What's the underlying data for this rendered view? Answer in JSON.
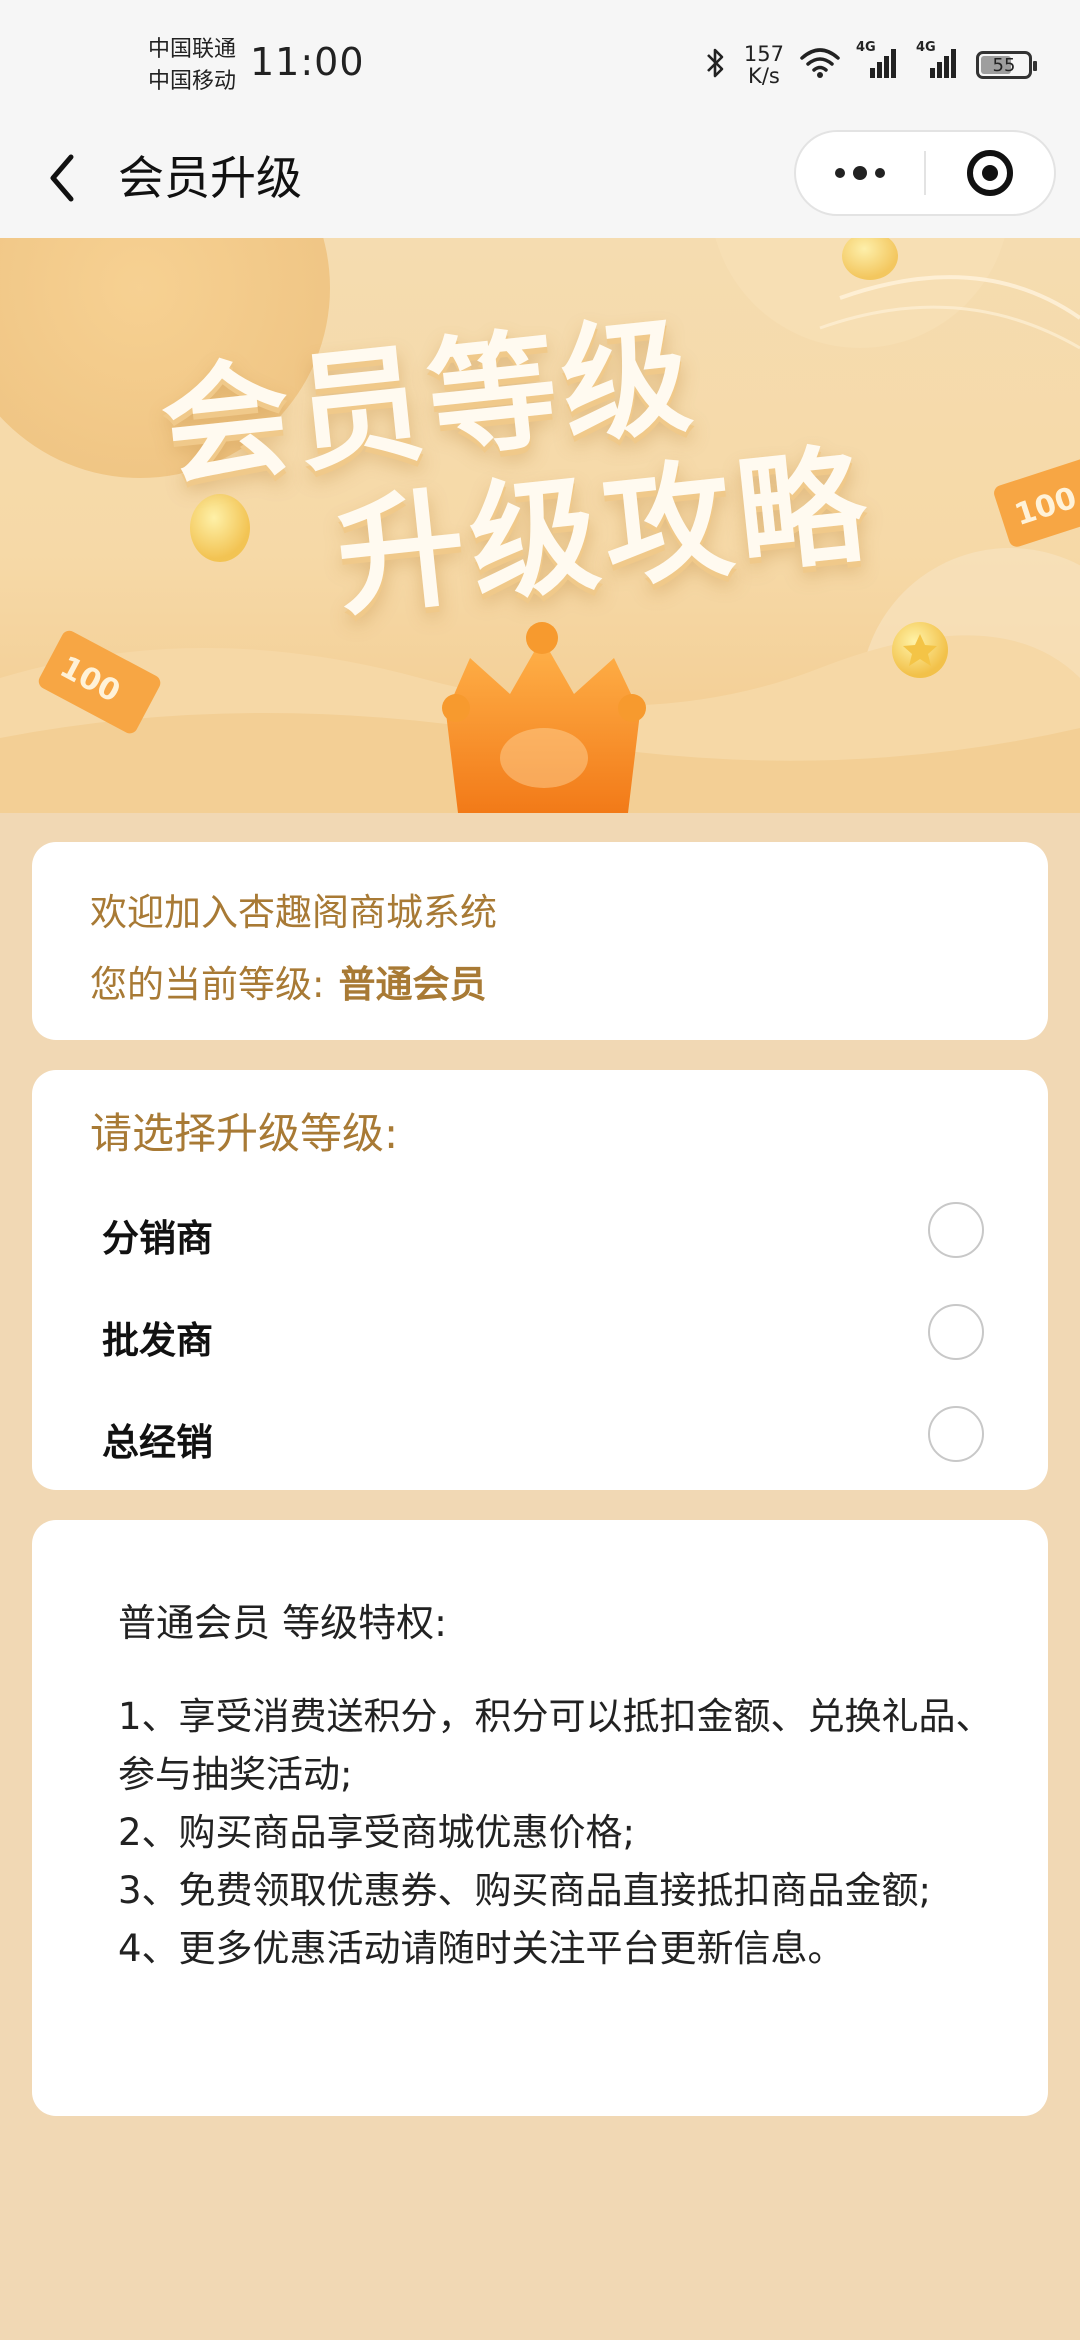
{
  "status_bar": {
    "carrier_1": "中国联通",
    "carrier_2": "中国移动",
    "time": "11:00",
    "speed_value": "157",
    "speed_unit": "K/s",
    "network_1": "4G",
    "network_2": "4G",
    "battery": "55",
    "icons": [
      "bluetooth-icon",
      "wifi-icon",
      "signal-icon",
      "battery-icon"
    ]
  },
  "nav": {
    "title": "会员升级",
    "icons": [
      "back-arrow-icon",
      "more-dots-icon",
      "close-target-icon"
    ]
  },
  "banner": {
    "line1": "会员等级",
    "line2": "升级攻略",
    "coin_label": "100"
  },
  "welcome_card": {
    "welcome_text": "欢迎加入杏趣阁商城系统",
    "level_label": "您的当前等级:",
    "level_value": "普通会员"
  },
  "upgrade_card": {
    "title": "请选择升级等级:",
    "options": [
      {
        "label": "分销商",
        "selected": false
      },
      {
        "label": "批发商",
        "selected": false
      },
      {
        "label": "总经销",
        "selected": false
      }
    ]
  },
  "privilege_card": {
    "title": "普通会员 等级特权:",
    "items": [
      "1、享受消费送积分，积分可以抵扣金额、兑换礼品、参与抽奖活动;",
      "2、购买商品享受商城优惠价格;",
      "3、免费领取优惠券、购买商品直接抵扣商品金额;",
      "4、更多优惠活动请随时关注平台更新信息。"
    ]
  },
  "colors": {
    "page_background": "#f1d8b4",
    "accent_brown": "#a87a35",
    "card_background": "#ffffff"
  }
}
